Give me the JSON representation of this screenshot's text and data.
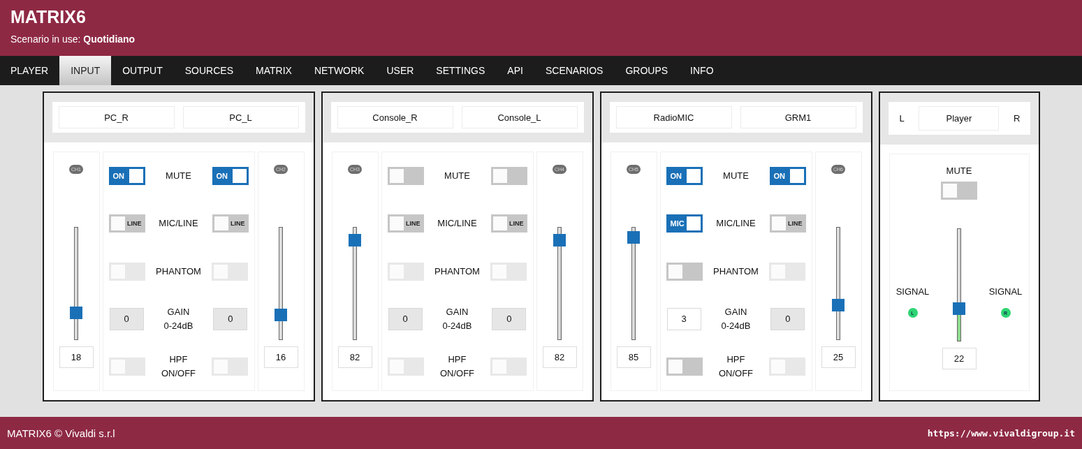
{
  "header": {
    "title": "MATRIX6",
    "scenario_label": "Scenario in use:",
    "scenario_name": "Quotidiano"
  },
  "nav": [
    {
      "label": "PLAYER",
      "selected": false
    },
    {
      "label": "INPUT",
      "selected": true
    },
    {
      "label": "OUTPUT",
      "selected": false
    },
    {
      "label": "SOURCES",
      "selected": false
    },
    {
      "label": "MATRIX",
      "selected": false
    },
    {
      "label": "NETWORK",
      "selected": false
    },
    {
      "label": "USER",
      "selected": false
    },
    {
      "label": "SETTINGS",
      "selected": false
    },
    {
      "label": "API",
      "selected": false
    },
    {
      "label": "SCENARIOS",
      "selected": false
    },
    {
      "label": "GROUPS",
      "selected": false
    },
    {
      "label": "INFO",
      "selected": false
    }
  ],
  "modules": [
    {
      "kind": "stereo",
      "names": [
        "PC_R",
        "PC_L"
      ],
      "channels": [
        {
          "badge": "CH1",
          "level": 0.24,
          "value": "18"
        },
        {
          "badge": "CH2",
          "level": 0.22,
          "value": "16"
        }
      ],
      "rows": [
        {
          "kind": "toggle",
          "label": [
            "MUTE"
          ],
          "left": {
            "on": true,
            "disabled": false,
            "text": "ON"
          },
          "right": {
            "on": true,
            "disabled": false,
            "text": "ON"
          }
        },
        {
          "kind": "toggle",
          "label": [
            "MIC/LINE"
          ],
          "left": {
            "on": false,
            "disabled": false,
            "text": "LINE"
          },
          "right": {
            "on": false,
            "disabled": false,
            "text": "LINE"
          }
        },
        {
          "kind": "toggle",
          "label": [
            "PHANTOM"
          ],
          "left": {
            "on": false,
            "disabled": true
          },
          "right": {
            "on": false,
            "disabled": true
          }
        },
        {
          "kind": "gain",
          "label": [
            "GAIN",
            "0-24dB"
          ],
          "left": {
            "value": "0",
            "disabled": true
          },
          "right": {
            "value": "0",
            "disabled": true
          }
        },
        {
          "kind": "toggle",
          "label": [
            "HPF",
            "ON/OFF"
          ],
          "left": {
            "on": false,
            "disabled": true
          },
          "right": {
            "on": false,
            "disabled": true
          }
        }
      ]
    },
    {
      "kind": "stereo",
      "names": [
        "Console_R",
        "Console_L"
      ],
      "channels": [
        {
          "badge": "CH3",
          "level": 0.88,
          "value": "82"
        },
        {
          "badge": "CH4",
          "level": 0.88,
          "value": "82"
        }
      ],
      "rows": [
        {
          "kind": "toggle",
          "label": [
            "MUTE"
          ],
          "left": {
            "on": false,
            "disabled": false
          },
          "right": {
            "on": false,
            "disabled": false
          }
        },
        {
          "kind": "toggle",
          "label": [
            "MIC/LINE"
          ],
          "left": {
            "on": false,
            "disabled": false,
            "text": "LINE"
          },
          "right": {
            "on": false,
            "disabled": false,
            "text": "LINE"
          }
        },
        {
          "kind": "toggle",
          "label": [
            "PHANTOM"
          ],
          "left": {
            "on": false,
            "disabled": true
          },
          "right": {
            "on": false,
            "disabled": true
          }
        },
        {
          "kind": "gain",
          "label": [
            "GAIN",
            "0-24dB"
          ],
          "left": {
            "value": "0",
            "disabled": true
          },
          "right": {
            "value": "0",
            "disabled": true
          }
        },
        {
          "kind": "toggle",
          "label": [
            "HPF",
            "ON/OFF"
          ],
          "left": {
            "on": false,
            "disabled": true
          },
          "right": {
            "on": false,
            "disabled": true
          }
        }
      ]
    },
    {
      "kind": "stereo",
      "names": [
        "RadioMIC",
        "GRM1"
      ],
      "channels": [
        {
          "badge": "CH5",
          "level": 0.91,
          "value": "85"
        },
        {
          "badge": "CH6",
          "level": 0.31,
          "value": "25"
        }
      ],
      "rows": [
        {
          "kind": "toggle",
          "label": [
            "MUTE"
          ],
          "left": {
            "on": true,
            "disabled": false,
            "text": "ON"
          },
          "right": {
            "on": true,
            "disabled": false,
            "text": "ON"
          }
        },
        {
          "kind": "toggle",
          "label": [
            "MIC/LINE"
          ],
          "left": {
            "on": true,
            "disabled": false,
            "text": "MIC"
          },
          "right": {
            "on": false,
            "disabled": false,
            "text": "LINE"
          }
        },
        {
          "kind": "toggle",
          "label": [
            "PHANTOM"
          ],
          "left": {
            "on": false,
            "disabled": false
          },
          "right": {
            "on": false,
            "disabled": true
          }
        },
        {
          "kind": "gain",
          "label": [
            "GAIN",
            "0-24dB"
          ],
          "left": {
            "value": "3",
            "disabled": false
          },
          "right": {
            "value": "0",
            "disabled": true
          }
        },
        {
          "kind": "toggle",
          "label": [
            "HPF",
            "ON/OFF"
          ],
          "left": {
            "on": false,
            "disabled": false
          },
          "right": {
            "on": false,
            "disabled": true
          }
        }
      ]
    },
    {
      "kind": "player",
      "left": "L",
      "name": "Player",
      "right": "R",
      "mute_label": "MUTE",
      "mute": {
        "on": false,
        "disabled": false
      },
      "signals": [
        {
          "label": "SIGNAL",
          "badge": "L",
          "color": "#2ed573"
        },
        {
          "label": "SIGNAL",
          "badge": "R",
          "color": "#2ed573"
        }
      ],
      "slider": {
        "level": 0.29,
        "value": "22",
        "filled": true
      }
    }
  ],
  "footer": {
    "copyright": "MATRIX6 © Vivaldi s.r.l",
    "url": "https://www.vivaldigroup.it"
  }
}
